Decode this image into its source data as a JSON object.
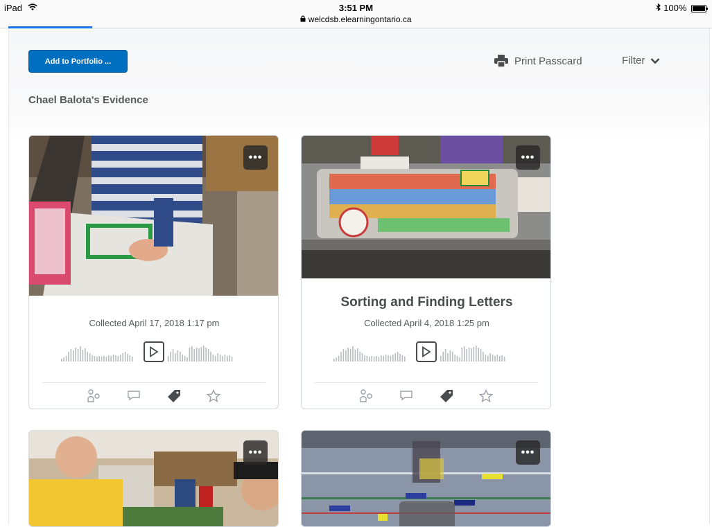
{
  "status_bar": {
    "device": "iPad",
    "time": "3:51 PM",
    "url": "welcdsb.elearningontario.ca",
    "battery": "100%"
  },
  "toolbar": {
    "add_label": "Add to Portfolio ...",
    "print_label": "Print Passcard",
    "filter_label": "Filter"
  },
  "section_title": "Chael Balota's Evidence",
  "cards": [
    {
      "title": "",
      "date": "Collected April 17, 2018 1:17 pm",
      "more": "•••"
    },
    {
      "title": "Sorting and Finding Letters",
      "date": "Collected April 4, 2018 1:25 pm",
      "more": "•••"
    },
    {
      "more": "•••"
    },
    {
      "more": "•••"
    }
  ],
  "icons": [
    "people-icon",
    "comment-icon",
    "tag-icon",
    "star-icon",
    "printer-icon",
    "chevron-down-icon",
    "play-icon",
    "wifi-icon",
    "lock-icon",
    "bluetooth-icon",
    "battery-icon"
  ],
  "colors": {
    "primary": "#006fbf",
    "text": "#494c4e",
    "accent_bar": "#1a73e8"
  }
}
